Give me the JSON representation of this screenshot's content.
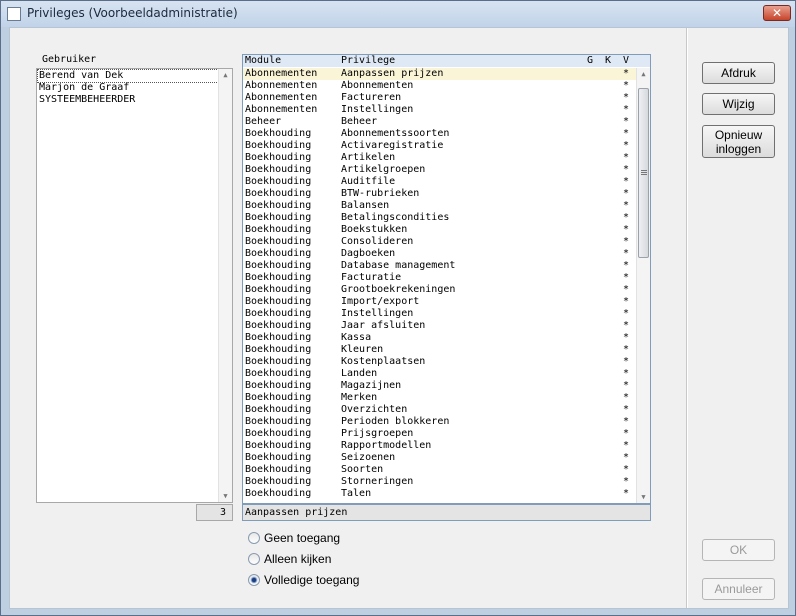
{
  "window": {
    "title": "Privileges (Voorbeeldadministratie)",
    "close_glyph": "✕"
  },
  "users": {
    "header": "Gebruiker",
    "items": [
      "Berend van Dek",
      "Marjon de Graaf",
      "SYSTEEMBEHEERDER"
    ],
    "selected": 0,
    "count": "3"
  },
  "grid": {
    "columns": {
      "module": "Module",
      "privilege": "Privilege",
      "g": "G",
      "k": "K",
      "v": "V"
    },
    "rows": [
      [
        "Abonnementen",
        "Aanpassen prijzen",
        "*"
      ],
      [
        "Abonnementen",
        "Abonnementen",
        "*"
      ],
      [
        "Abonnementen",
        "Factureren",
        "*"
      ],
      [
        "Abonnementen",
        "Instellingen",
        "*"
      ],
      [
        "Beheer",
        "Beheer",
        "*"
      ],
      [
        "Boekhouding",
        "Abonnementssoorten",
        "*"
      ],
      [
        "Boekhouding",
        "Activaregistratie",
        "*"
      ],
      [
        "Boekhouding",
        "Artikelen",
        "*"
      ],
      [
        "Boekhouding",
        "Artikelgroepen",
        "*"
      ],
      [
        "Boekhouding",
        "Auditfile",
        "*"
      ],
      [
        "Boekhouding",
        "BTW-rubrieken",
        "*"
      ],
      [
        "Boekhouding",
        "Balansen",
        "*"
      ],
      [
        "Boekhouding",
        "Betalingscondities",
        "*"
      ],
      [
        "Boekhouding",
        "Boekstukken",
        "*"
      ],
      [
        "Boekhouding",
        "Consolideren",
        "*"
      ],
      [
        "Boekhouding",
        "Dagboeken",
        "*"
      ],
      [
        "Boekhouding",
        "Database management",
        "*"
      ],
      [
        "Boekhouding",
        "Facturatie",
        "*"
      ],
      [
        "Boekhouding",
        "Grootboekrekeningen",
        "*"
      ],
      [
        "Boekhouding",
        "Import/export",
        "*"
      ],
      [
        "Boekhouding",
        "Instellingen",
        "*"
      ],
      [
        "Boekhouding",
        "Jaar afsluiten",
        "*"
      ],
      [
        "Boekhouding",
        "Kassa",
        "*"
      ],
      [
        "Boekhouding",
        "Kleuren",
        "*"
      ],
      [
        "Boekhouding",
        "Kostenplaatsen",
        "*"
      ],
      [
        "Boekhouding",
        "Landen",
        "*"
      ],
      [
        "Boekhouding",
        "Magazijnen",
        "*"
      ],
      [
        "Boekhouding",
        "Merken",
        "*"
      ],
      [
        "Boekhouding",
        "Overzichten",
        "*"
      ],
      [
        "Boekhouding",
        "Perioden blokkeren",
        "*"
      ],
      [
        "Boekhouding",
        "Prijsgroepen",
        "*"
      ],
      [
        "Boekhouding",
        "Rapportmodellen",
        "*"
      ],
      [
        "Boekhouding",
        "Seizoenen",
        "*"
      ],
      [
        "Boekhouding",
        "Soorten",
        "*"
      ],
      [
        "Boekhouding",
        "Storneringen",
        "*"
      ],
      [
        "Boekhouding",
        "Talen",
        "*"
      ]
    ],
    "selected": 0,
    "status": "Aanpassen prijzen"
  },
  "access": {
    "options": [
      "Geen toegang",
      "Alleen kijken",
      "Volledige toegang"
    ],
    "selected": 2
  },
  "buttons": {
    "print": "Afdruk",
    "edit": "Wijzig",
    "relogin_line1": "Opnieuw",
    "relogin_line2": "inloggen",
    "ok": "OK",
    "cancel": "Annuleer"
  },
  "icons": {
    "scroll_up": "up-arrow-icon",
    "scroll_down": "down-arrow-icon"
  }
}
